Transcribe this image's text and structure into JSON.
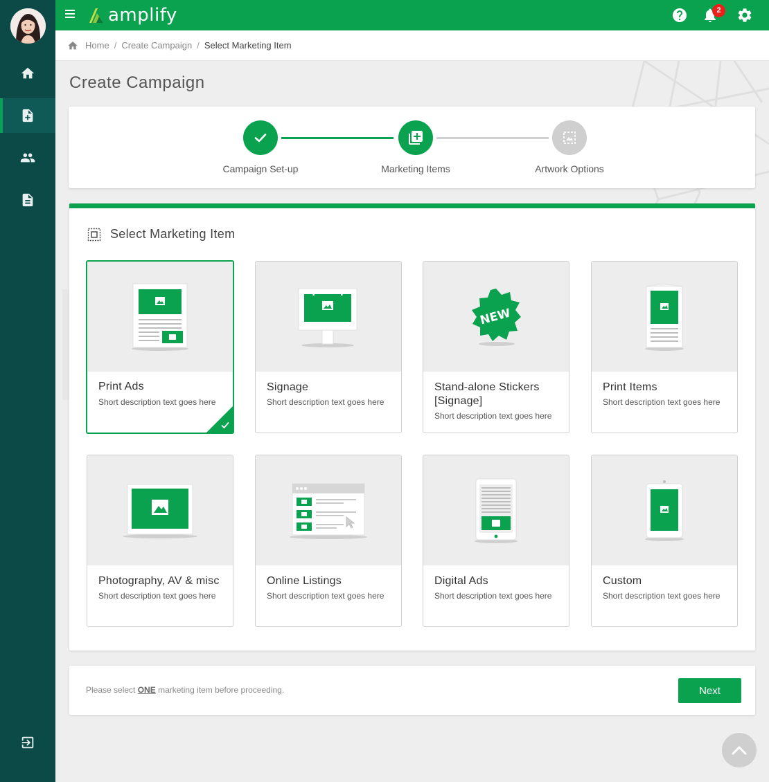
{
  "app": {
    "logo_text": "amplify",
    "notification_count": "2"
  },
  "sidebar": {
    "items": [
      {
        "name": "home",
        "icon": "home-icon"
      },
      {
        "name": "create-campaign",
        "icon": "add-document-icon",
        "active": true
      },
      {
        "name": "users",
        "icon": "people-icon"
      },
      {
        "name": "documents",
        "icon": "document-icon"
      }
    ],
    "logout_icon": "logout-icon"
  },
  "breadcrumb": {
    "home": "Home",
    "create": "Create Campaign",
    "current": "Select Marketing Item"
  },
  "page_title": "Create Campaign",
  "stepper": {
    "steps": [
      {
        "label": "Campaign Set-up",
        "state": "done"
      },
      {
        "label": "Marketing Items",
        "state": "current"
      },
      {
        "label": "Artwork Options",
        "state": "todo"
      }
    ]
  },
  "section_title": "Select Marketing Item",
  "items": [
    {
      "title": "Print Ads",
      "desc": "Short description text goes here",
      "selected": true
    },
    {
      "title": "Signage",
      "desc": "Short description text goes here"
    },
    {
      "title": "Stand-alone Stickers [Signage]",
      "desc": "Short description text goes here",
      "badge": "NEW"
    },
    {
      "title": "Print Items",
      "desc": "Short description text goes here"
    },
    {
      "title": "Photography, AV & misc",
      "desc": "Short description text goes here"
    },
    {
      "title": "Online Listings",
      "desc": "Short description text goes here"
    },
    {
      "title": "Digital Ads",
      "desc": "Short description text goes here"
    },
    {
      "title": "Custom",
      "desc": "Short description text goes here"
    }
  ],
  "footer": {
    "msg_pre": "Please select ",
    "msg_emph": "ONE",
    "msg_post": " marketing item before proceeding.",
    "next_label": "Next"
  },
  "colors": {
    "brand": "#0aa24e",
    "sidebar": "#0c4a48",
    "badge": "#e8221b"
  }
}
